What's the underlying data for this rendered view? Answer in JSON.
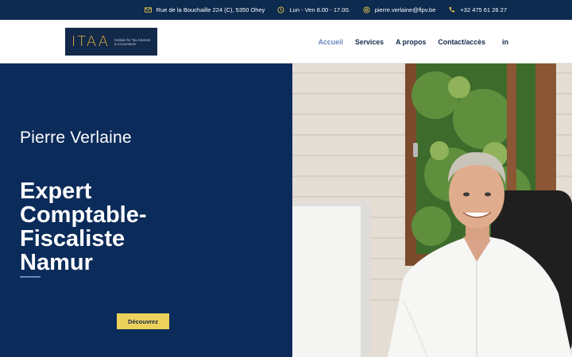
{
  "topbar": {
    "address": "Rue de la Bouchaille 224 (C), 5350 Ohey",
    "hours": "Lun - Ven 8.00 - 17.00.",
    "email": "pierre.verlaine@flpv.be",
    "phone": "+32 475 61 26 27"
  },
  "logo": {
    "mark": "ITAA",
    "tagline": "Institute for Tax Advisors & Accountants"
  },
  "nav": {
    "items": [
      {
        "label": "Accueil",
        "active": true
      },
      {
        "label": "Services",
        "active": false
      },
      {
        "label": "A propos",
        "active": false
      },
      {
        "label": "Contact/accès",
        "active": false
      }
    ],
    "linkedin": "in"
  },
  "hero": {
    "name": "Pierre Verlaine",
    "title_lines": [
      "Expert",
      "Comptable-",
      "Fiscaliste",
      "Namur"
    ],
    "cta": "Découvrez"
  },
  "colors": {
    "navy": "#0b2b5a",
    "topbar": "#0d2a4f",
    "accent_yellow": "#ecd15a",
    "active_nav": "#6a88c0"
  }
}
